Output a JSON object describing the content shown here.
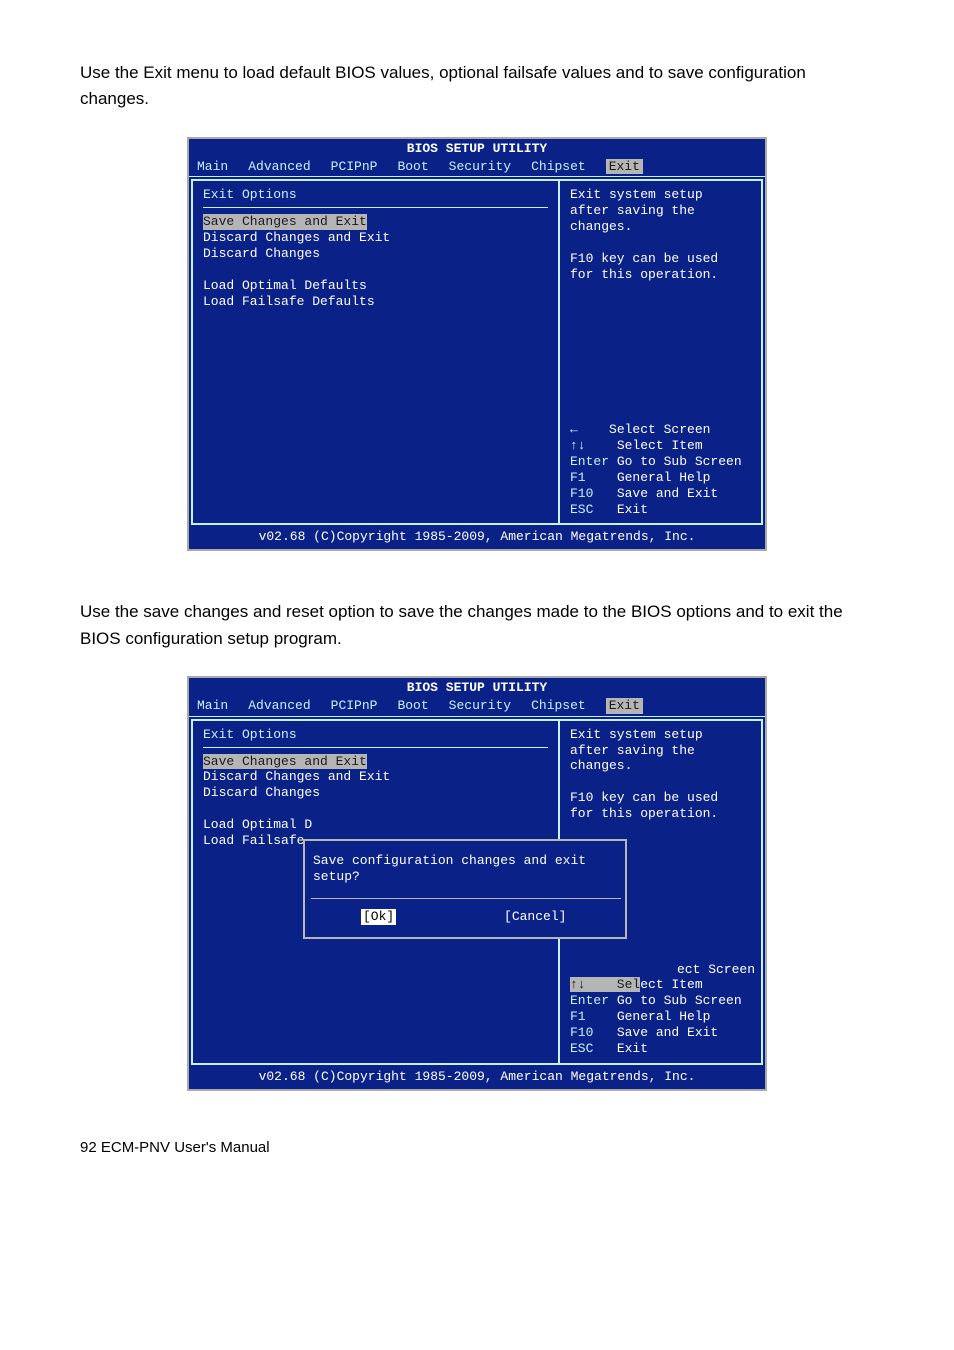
{
  "doc": {
    "para1": "Use the Exit menu to load default BIOS values, optional failsafe values and to save configuration changes.",
    "para2": "Use the save changes and reset option to save the changes made to the BIOS options and to exit the BIOS configuration setup program.",
    "page_footer": "92 ECM-PNV User's Manual"
  },
  "bios1": {
    "title": "BIOS SETUP UTILITY",
    "tabs": [
      "Main",
      "Advanced",
      "PCIPnP",
      "Boot",
      "Security",
      "Chipset",
      "Exit"
    ],
    "section": "Exit Options",
    "items": [
      "Save Changes and Exit",
      "Discard Changes and Exit",
      "Discard Changes",
      "",
      "Load Optimal Defaults",
      "Load Failsafe Defaults"
    ],
    "help_top": "Exit system setup\nafter saving the\nchanges.\n\nF10 key can be used\nfor this operation.",
    "keys": {
      "left": "←    Select Screen",
      "updown": "↑↓    Select Item",
      "enter": "Enter Go to Sub Screen",
      "f1": "F1    General Help",
      "f10": "F10   Save and Exit",
      "esc": "ESC   Exit"
    },
    "footer": "v02.68 (C)Copyright 1985-2009, American Megatrends, Inc."
  },
  "bios2": {
    "title": "BIOS SETUP UTILITY",
    "tabs": [
      "Main",
      "Advanced",
      "PCIPnP",
      "Boot",
      "Security",
      "Chipset",
      "Exit"
    ],
    "section": "Exit Options",
    "items": [
      "Save Changes and Exit",
      "Discard Changes and Exit",
      "Discard Changes",
      "",
      "Load Optimal D",
      "Load Failsafe"
    ],
    "help_top": "Exit system setup\nafter saving the\nchanges.\n\nF10 key can be used\nfor this operation.",
    "dialog": {
      "question": "Save configuration changes and exit setup?",
      "ok": "[Ok]",
      "cancel": "[Cancel]"
    },
    "keys": {
      "left_partial": "ect Screen",
      "updown_pre": "↑↓    Sel",
      "updown_post": "ect Item",
      "enter": "Enter Go to Sub Screen",
      "f1": "F1    General Help",
      "f10": "F10   Save and Exit",
      "esc": "ESC   Exit"
    },
    "footer": "v02.68 (C)Copyright 1985-2009, American Megatrends, Inc."
  }
}
